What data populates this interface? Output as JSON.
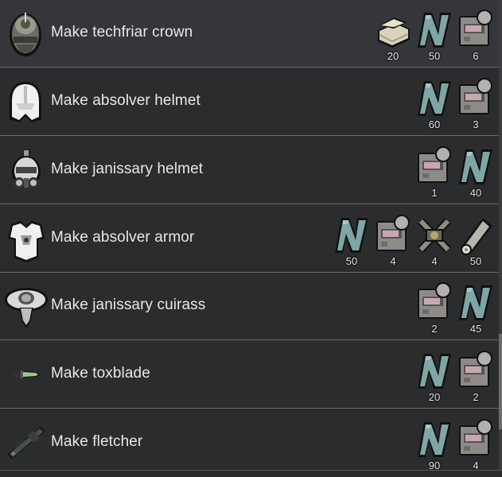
{
  "bills": [
    {
      "label": "Make techfriar crown",
      "product_icon": "techfriar-crown-icon",
      "ingredients": [
        {
          "icon": "cloth-stack-icon",
          "count": "20"
        },
        {
          "icon": "plasteel-icon",
          "count": "50"
        },
        {
          "icon": "component-icon",
          "count": "6"
        }
      ]
    },
    {
      "label": "Make absolver helmet",
      "product_icon": "absolver-helmet-icon",
      "ingredients": [
        {
          "icon": "plasteel-icon",
          "count": "60"
        },
        {
          "icon": "component-icon",
          "count": "3"
        }
      ]
    },
    {
      "label": "Make janissary helmet",
      "product_icon": "janissary-helmet-icon",
      "ingredients": [
        {
          "icon": "component-icon",
          "count": "1"
        },
        {
          "icon": "plasteel-icon",
          "count": "40"
        }
      ]
    },
    {
      "label": "Make absolver armor",
      "product_icon": "absolver-armor-icon",
      "ingredients": [
        {
          "icon": "plasteel-icon",
          "count": "50"
        },
        {
          "icon": "component-icon",
          "count": "4"
        },
        {
          "icon": "advanced-component-icon",
          "count": "4"
        },
        {
          "icon": "uranium-icon",
          "count": "50"
        }
      ]
    },
    {
      "label": "Make janissary cuirass",
      "product_icon": "janissary-cuirass-icon",
      "ingredients": [
        {
          "icon": "component-icon",
          "count": "2"
        },
        {
          "icon": "plasteel-icon",
          "count": "45"
        }
      ]
    },
    {
      "label": "Make toxblade",
      "product_icon": "toxblade-icon",
      "ingredients": [
        {
          "icon": "plasteel-icon",
          "count": "20"
        },
        {
          "icon": "component-icon",
          "count": "2"
        }
      ]
    },
    {
      "label": "Make fletcher",
      "product_icon": "fletcher-icon",
      "ingredients": [
        {
          "icon": "plasteel-icon",
          "count": "90"
        },
        {
          "icon": "component-icon",
          "count": "4"
        }
      ]
    }
  ],
  "colors": {
    "plasteel": "#7fa6a6",
    "component": "#8d8b88",
    "cloth": "#d9d2bd",
    "uranium": "#b7b4ae",
    "text": "#e8e8e8"
  }
}
